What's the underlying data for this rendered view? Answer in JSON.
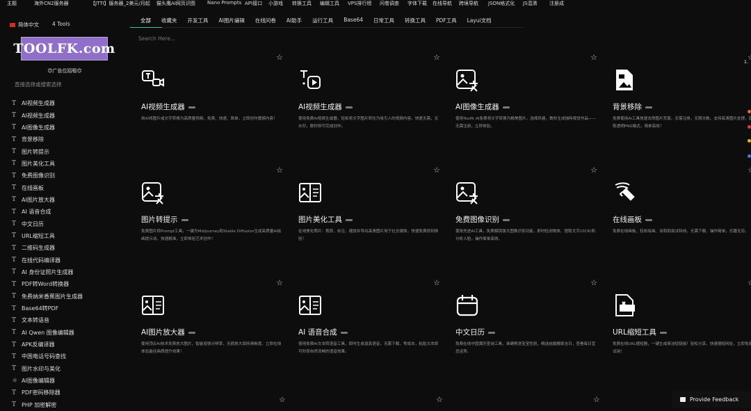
{
  "top_nav": [
    "主题",
    "海外CN2服务器",
    "【JTTI】服务器_2美元/月起",
    "猫头鹰AI网页识图",
    "Nano Prompts",
    "API接口",
    "小游戏",
    "转换工具",
    "编辑工具",
    "VPS排行榜",
    "问卷调查",
    "字体下载",
    "在线导航",
    "跨境导航",
    "JSON格式化",
    "JS混淆",
    "注册成"
  ],
  "sidebar": {
    "language": "简体中文",
    "tools_count": "4 Tools",
    "logo_text": "TOOLFK.com",
    "ad_text": "😊广告位招租😊",
    "search_placeholder": "直接选择或搜索选择",
    "items": [
      "AI视频生成器",
      "AI视频生成器",
      "AI图像生成器",
      "背景移除",
      "图片转提示",
      "图片美化工具",
      "免费图像识别",
      "在线画板",
      "AI图片放大器",
      "AI 语音合成",
      "中文日历",
      "URL缩短工具",
      "二维码生成器",
      "在线代码编译器",
      "AI 身份证照片生成器",
      "PDF转Word转换器",
      "免费纳米香蕉图片生成器",
      "Base64转PDF",
      "文本转语音",
      "AI Qwen 图像编辑器",
      "APK反编译器",
      "中国电话号码查找",
      "图片水印与美化",
      "AI图像编辑器",
      "PDF密码移除器",
      "PHP 加密解密"
    ]
  },
  "tabs": [
    "全部",
    "收藏夹",
    "开发工具",
    "AI图片编辑",
    "在线问卷",
    "AI助手",
    "运行工具",
    "Base64",
    "日常工具",
    "转换工具",
    "PDF工具",
    "Layui文档"
  ],
  "search_placeholder": "Search Here...",
  "cards": [
    {
      "title": "AI视频生成器",
      "icon": "image-to-video-icon",
      "desc": "用AI将图片或文字转换为高质量视频。免费、快速、简单，立即创作震撼内容！"
    },
    {
      "title": "AI视频生成器",
      "icon": "text-to-video-icon",
      "desc": "使用免费AI视频生成器，轻松将文字图片转化为吸引人的视频内容。快速无需，无水印，数秒即可完成创作。"
    },
    {
      "title": "AI图像生成器",
      "icon": "image-text-icon",
      "desc": "使用Toolfk AI免费将文字转换为精美图片。选择风格，数秒生成独特视觉作品——无需注册，立即体验。"
    },
    {
      "title": "背景移除",
      "icon": "image-file-icon",
      "desc": "免费使用AI工具快速去除图片背景。无需注册，无限次数。支持高清图片处理，获取透明PNG格式，简单高效！"
    },
    {
      "title": "图片转提示",
      "icon": "image-text-icon",
      "desc": "免费图片转Prompt工具，一键为Midjourney和Stable Diffusion生成高质量AI绘画提示词。快速精准，立即体验艺术创作！"
    },
    {
      "title": "图片美化工具",
      "icon": "book-image-icon",
      "desc": "在线美化照片：裁剪、标注、缩放并导出高清图片用于社交媒体，快速免费即刻体验！"
    },
    {
      "title": "免费图像识别",
      "icon": "image-text-icon",
      "desc": "使用先进AI工具，免费解锁强大图像识别功能，即时检测物体、提取文字(OCR)和分析人脸，操作简单高效。"
    },
    {
      "title": "在线画板",
      "icon": "brush-icon",
      "desc": "免费在线画板，轻松绘画、涂鸦和尝试特效。无需下载，操作简单，乐趣无穷。"
    },
    {
      "title": "AI图片放大器",
      "icon": "book-image-icon",
      "desc": "使用顶尖AI技术免费放大图片，智能增强分辨率，无损放大保持清晰度。立即在线体验最佳画质提升效果！"
    },
    {
      "title": "AI 语音合成",
      "icon": "book-image-icon",
      "desc": "使用免费AI文本转语音工具，即时生成逼真语音，无需下载，零成本，粘贴文本即可秒获自然流畅的语音效果。"
    },
    {
      "title": "中文日历",
      "icon": "calendar-icon",
      "desc": "免费在线中国黄历查询工具，准确预测宝宝性别，精选结婚搬家吉日，查看每日宜忌运势。"
    },
    {
      "title": "URL缩短工具",
      "icon": "url-file-icon",
      "desc": "免费在线URL缩短器，一键生成简洁短链接！轻松分享，快速缩短网址，立即免费试用！"
    }
  ],
  "right_edge": "1.",
  "feedback": "Provide Feedback"
}
